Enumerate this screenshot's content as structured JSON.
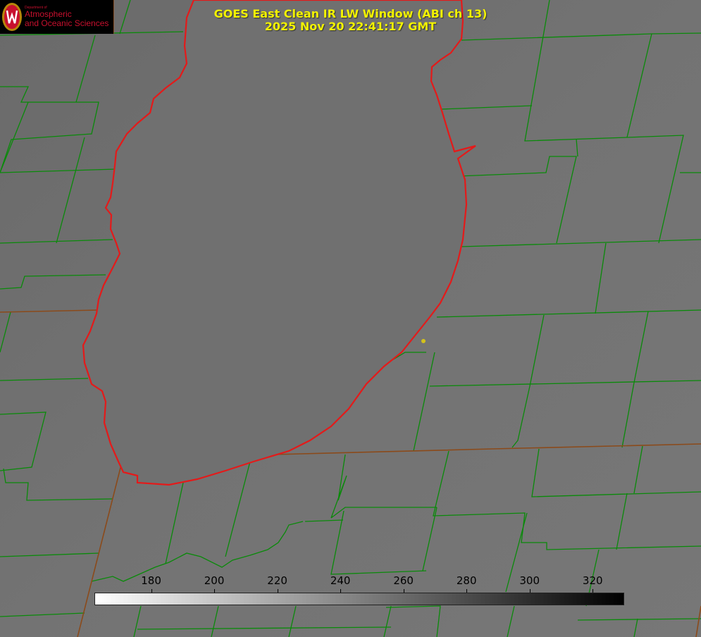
{
  "title": {
    "line1": "GOES East Clean IR LW Window (ABI ch 13)",
    "line2": "2025 Nov 20 22:41:17 GMT"
  },
  "logo": {
    "dept": "Department of",
    "line1": "Atmospheric",
    "line2": "and Oceanic Sciences",
    "seal_icon": "uw-crest-icon",
    "colors": {
      "background": "#000000",
      "text": "#c8102e"
    }
  },
  "colorbar": {
    "ticks": [
      "180",
      "200",
      "220",
      "240",
      "260",
      "280",
      "300",
      "320"
    ],
    "tick_values": [
      180,
      200,
      220,
      240,
      260,
      280,
      300,
      320
    ],
    "range": [
      162,
      330
    ],
    "gradient": "white-to-black"
  },
  "map": {
    "colors": {
      "background": "#6e6e6e",
      "lake_fill": "#707070",
      "lake_outline": "#e41a1a",
      "county_lines": "#0a8a0a",
      "state_lines": "#8b4a1a",
      "marker": "#d4c21a",
      "title": "#f2f200"
    }
  }
}
